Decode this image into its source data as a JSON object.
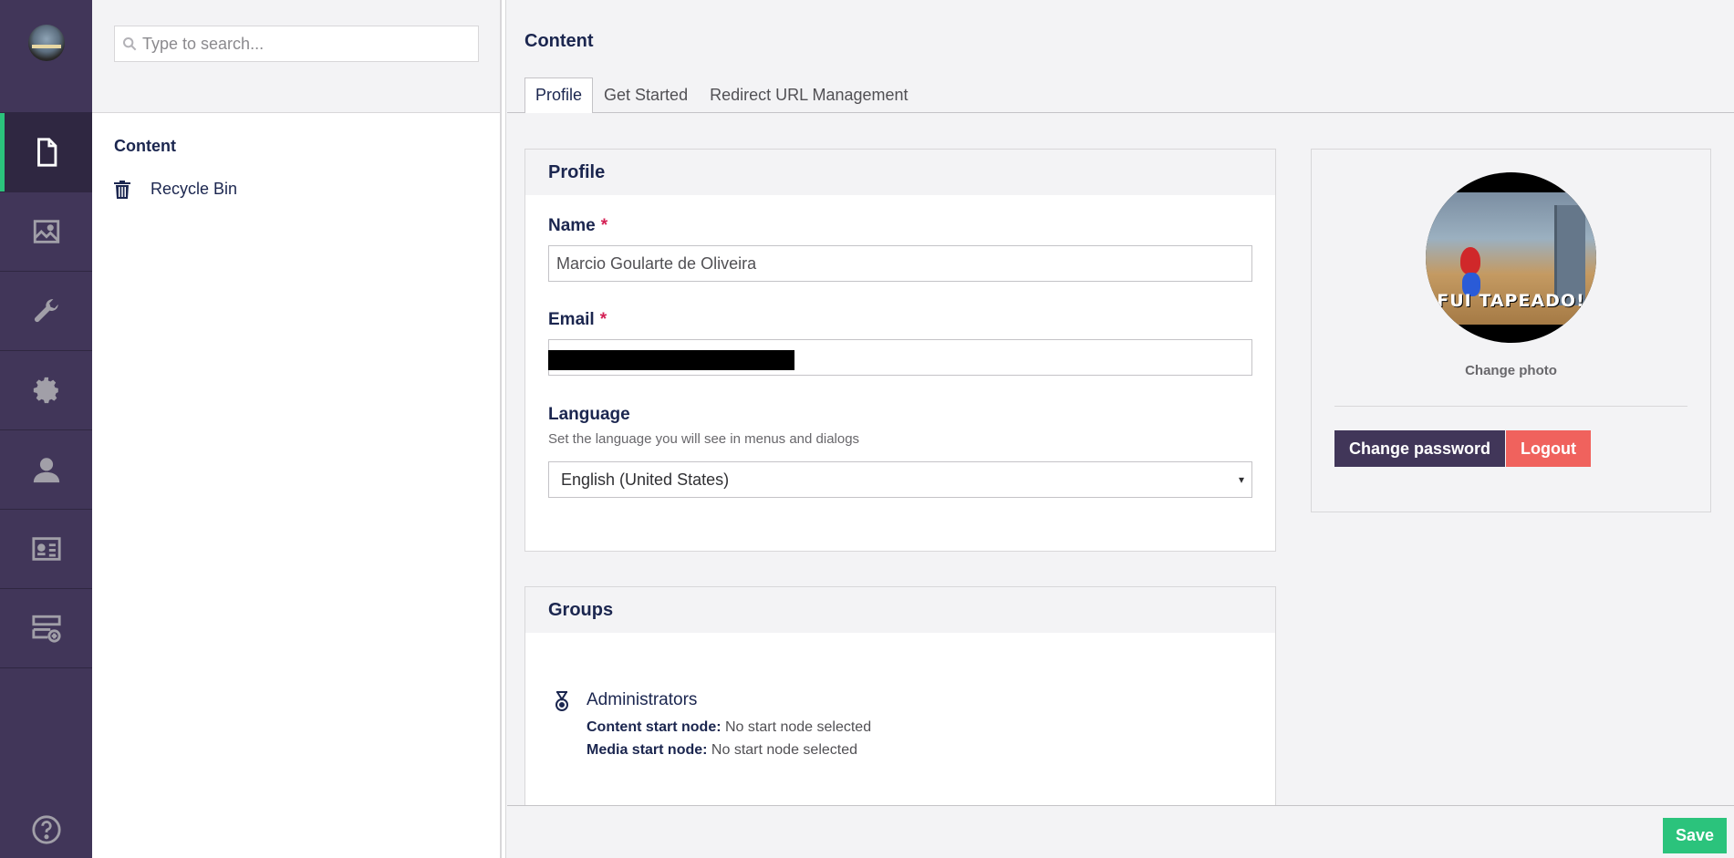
{
  "colors": {
    "app_bar": "#413659",
    "accent": "#2bc37c",
    "danger": "#f0625d",
    "required": "#d42054"
  },
  "sections": [
    {
      "name": "content",
      "icon": "document-icon",
      "active": true
    },
    {
      "name": "media",
      "icon": "image-icon"
    },
    {
      "name": "settings",
      "icon": "wrench-icon"
    },
    {
      "name": "packages",
      "icon": "gear-icon"
    },
    {
      "name": "users",
      "icon": "user-icon"
    },
    {
      "name": "members",
      "icon": "id-card-icon"
    },
    {
      "name": "forms",
      "icon": "form-add-icon"
    }
  ],
  "help_icon": "help-icon",
  "tree": {
    "search_placeholder": "Type to search...",
    "root_label": "Content",
    "recycle_bin_label": "Recycle Bin"
  },
  "header": {
    "title": "Content",
    "tabs": [
      "Profile",
      "Get Started",
      "Redirect URL Management"
    ],
    "active_tab": "Profile"
  },
  "profile": {
    "box_title": "Profile",
    "name_label": "Name",
    "name_value": "Marcio Goularte de Oliveira",
    "email_label": "Email",
    "required_marker": "*",
    "language_label": "Language",
    "language_description": "Set the language you will see in menus and dialogs",
    "language_value": "English (United States)",
    "select_caret": "▾"
  },
  "groups": {
    "box_title": "Groups",
    "items": [
      {
        "name": "Administrators",
        "content_start_label": "Content start node:",
        "content_start_value": "No start node selected",
        "media_start_label": "Media start node:",
        "media_start_value": "No start node selected"
      }
    ]
  },
  "avatar_panel": {
    "photo_caption": "FUI TAPEADO!",
    "change_photo_label": "Change photo",
    "change_password_label": "Change password",
    "logout_label": "Logout"
  },
  "footer": {
    "save_label": "Save"
  }
}
